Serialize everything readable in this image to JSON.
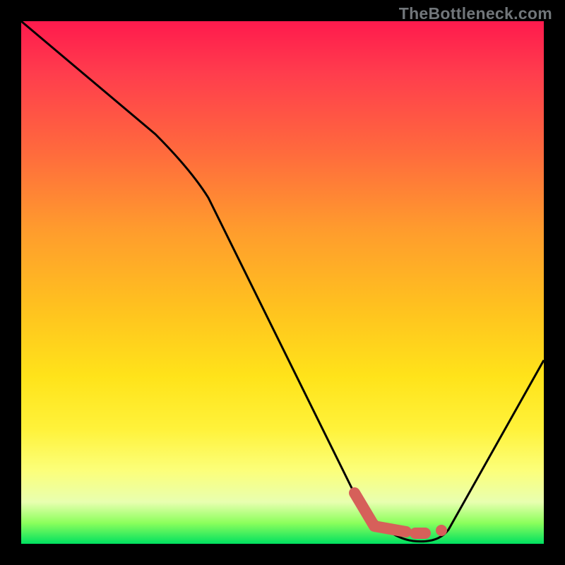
{
  "watermark": "TheBottleneck.com",
  "chart_data": {
    "type": "line",
    "title": "",
    "xlabel": "",
    "ylabel": "",
    "xlim": [
      0,
      100
    ],
    "ylim": [
      0,
      100
    ],
    "series": [
      {
        "name": "bottleneck-curve",
        "x": [
          0,
          25,
          35,
          64,
          70,
          75,
          80,
          100
        ],
        "y": [
          100,
          78,
          70,
          10,
          2,
          0,
          0.5,
          35
        ]
      }
    ],
    "markers": [
      {
        "name": "highlight-segment",
        "x": [
          64,
          68,
          73.5
        ],
        "y": [
          10,
          3,
          2
        ]
      },
      {
        "name": "highlight-dash",
        "x": [
          75,
          77
        ],
        "y": [
          1.8,
          1.8
        ]
      },
      {
        "name": "highlight-dot",
        "x": 80,
        "y": 2
      }
    ],
    "colors": {
      "curve": "#000000",
      "marker": "#d6605a",
      "gradient_top": "#ff1a4d",
      "gradient_bottom": "#00e060"
    }
  }
}
